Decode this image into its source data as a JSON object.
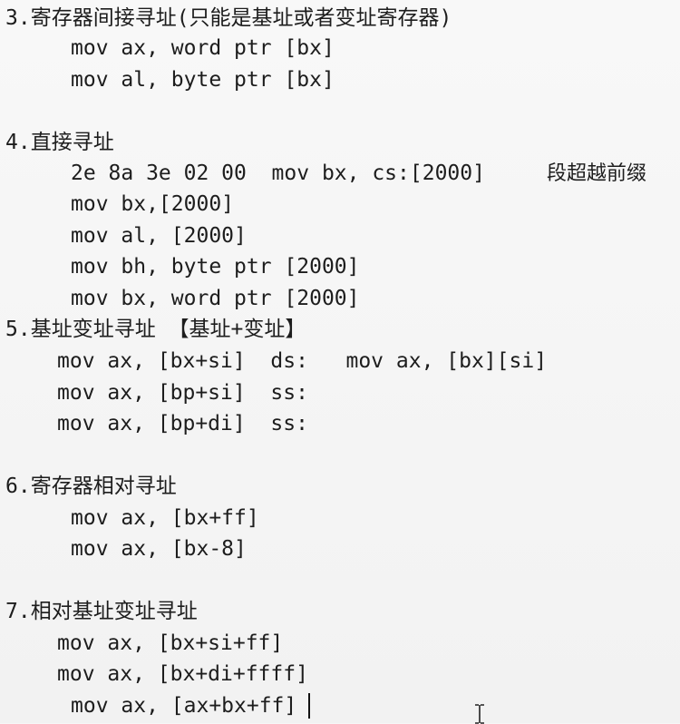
{
  "sections": [
    {
      "heading": "3.寄存器间接寻址(只能是基址或者变址寄存器)",
      "lines": [
        "mov ax, word ptr [bx]",
        "mov al, byte ptr [bx]"
      ]
    },
    {
      "heading": "4.直接寻址",
      "lines": [
        "2e 8a 3e 02 00  mov bx, cs:[2000]",
        "mov bx,[2000]",
        "mov al, [2000]",
        "mov bh, byte ptr [2000]",
        "mov bx, word ptr [2000]"
      ],
      "note": "段超越前缀"
    },
    {
      "heading": "5.基址变址寻址 【基址+变址】",
      "lines": [
        "mov ax, [bx+si]  ds:   mov ax, [bx][si]",
        "mov ax, [bp+si]  ss:",
        "mov ax, [bp+di]  ss:"
      ]
    },
    {
      "heading": "6.寄存器相对寻址",
      "lines": [
        "mov ax, [bx+ff]",
        "mov ax, [bx-8]"
      ]
    },
    {
      "heading": "7.相对基址变址寻址",
      "lines": [
        "mov ax, [bx+si+ff]",
        "mov ax, [bx+di+ffff]",
        "mov ax, [ax+bx+ff]"
      ]
    }
  ],
  "icons": {
    "caret": "text-caret-icon",
    "pointer": "i-beam-cursor-icon"
  }
}
